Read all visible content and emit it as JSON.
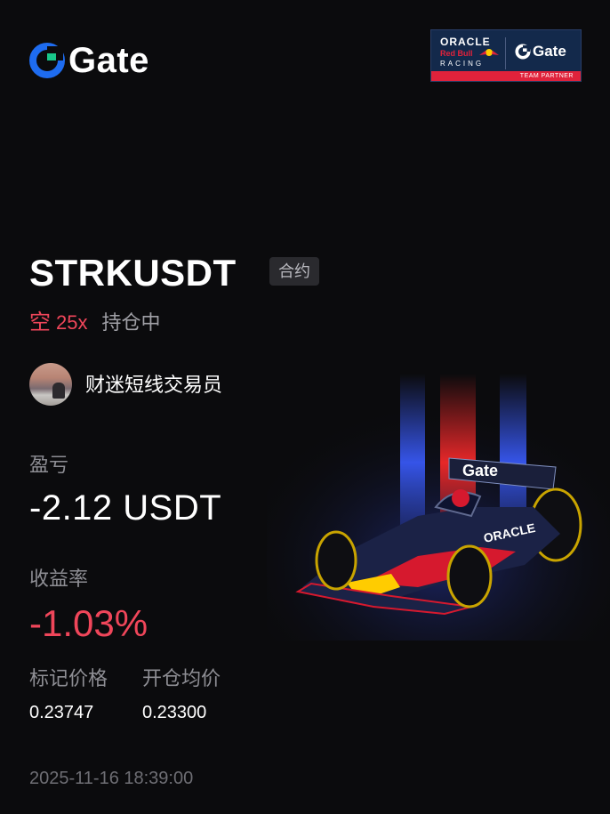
{
  "brand": {
    "name": "Gate",
    "icon": "gate-logo-icon"
  },
  "sponsor": {
    "oracle": "ORACLE",
    "redbull": "Red Bull",
    "racing": "RACING",
    "gate": "Gate",
    "partner": "TEAM PARTNER"
  },
  "position": {
    "pair": "STRKUSDT",
    "type_tag": "合约",
    "direction": "空",
    "leverage": "25x",
    "status": "持仓中"
  },
  "user": {
    "name": "财迷短线交易员"
  },
  "pnl": {
    "label": "盈亏",
    "value": "-2.12 USDT"
  },
  "roe": {
    "label": "收益率",
    "value": "-1.03%"
  },
  "mark_price": {
    "label": "标记价格",
    "value": "0.23747"
  },
  "entry_price": {
    "label": "开仓均价",
    "value": "0.23300"
  },
  "timestamp": "2025-11-16 18:39:00",
  "colors": {
    "loss": "#f0465a",
    "background": "#0b0b0d",
    "brand_blue": "#1e6cf0",
    "brand_green": "#19c78a"
  },
  "illustration": {
    "car_text": "Gate",
    "car_sponsor": "ORACLE"
  }
}
